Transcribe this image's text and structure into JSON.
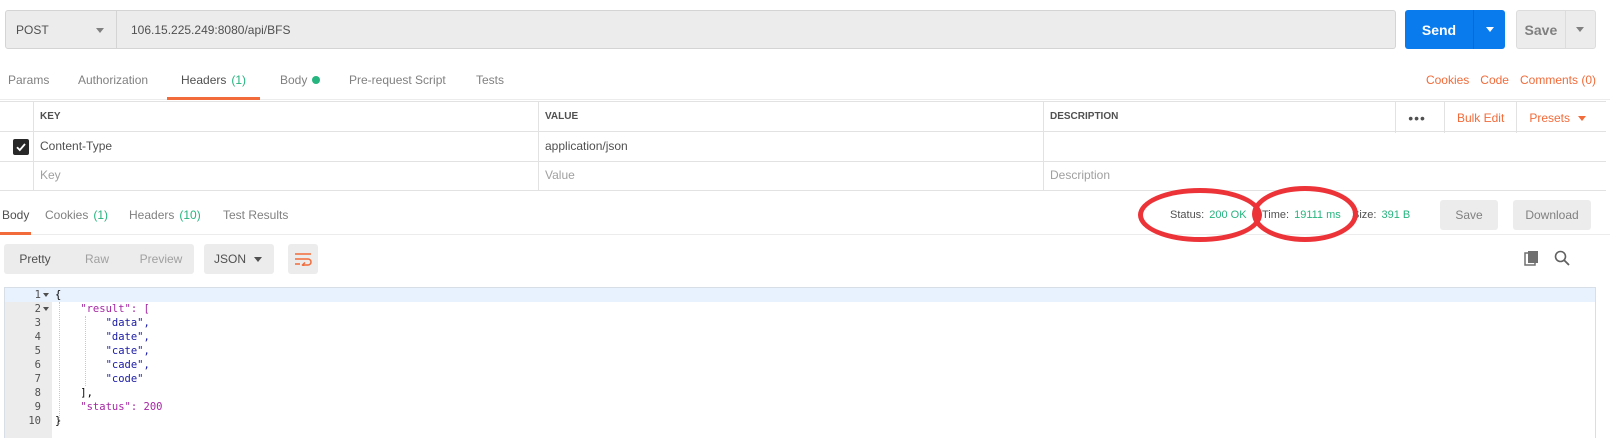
{
  "request": {
    "method": "POST",
    "url": "106.15.225.249:8080/api/BFS",
    "send_label": "Send",
    "save_label": "Save"
  },
  "request_tabs": [
    {
      "label": "Params",
      "count": ""
    },
    {
      "label": "Authorization",
      "count": ""
    },
    {
      "label": "Headers",
      "count": "(1)"
    },
    {
      "label": "Body",
      "count": ""
    },
    {
      "label": "Pre-request Script",
      "count": ""
    },
    {
      "label": "Tests",
      "count": ""
    }
  ],
  "active_request_tab": "Headers",
  "request_links": {
    "cookies": "Cookies",
    "code": "Code",
    "comments": "Comments (0)"
  },
  "headers_table": {
    "columns": [
      "KEY",
      "VALUE",
      "DESCRIPTION"
    ],
    "rows": [
      {
        "checked": true,
        "key": "Content-Type",
        "value": "application/json",
        "description": ""
      }
    ],
    "placeholders": {
      "key": "Key",
      "value": "Value",
      "description": "Description"
    },
    "actions": {
      "more": "•••",
      "bulk_edit": "Bulk Edit",
      "presets": "Presets"
    }
  },
  "response_tabs": [
    {
      "label": "Body",
      "count": ""
    },
    {
      "label": "Cookies",
      "count": "(1)"
    },
    {
      "label": "Headers",
      "count": "(10)"
    },
    {
      "label": "Test Results",
      "count": ""
    }
  ],
  "response_meta": {
    "status_label": "Status:",
    "status_value": "200 OK",
    "time_label": "Time:",
    "time_value": "19111 ms",
    "size_label": "Size:",
    "size_value": "391 B",
    "save_label": "Save",
    "download_label": "Download"
  },
  "view_modes": [
    "Pretty",
    "Raw",
    "Preview"
  ],
  "active_view_mode": "Pretty",
  "format": "JSON",
  "icons": {
    "wrap": "wrap-lines-icon",
    "copy": "copy-icon",
    "search": "search-icon",
    "checkbox": "checkmark-icon"
  },
  "colors": {
    "accent_orange": "#f26b3a",
    "send_blue": "#097bed",
    "status_green": "#26b47f",
    "annotation_red": "#ec3338"
  },
  "code_lines": [
    {
      "n": "1",
      "text": "{"
    },
    {
      "n": "2",
      "text": "    \"result\": ["
    },
    {
      "n": "3",
      "text": "        \"data\","
    },
    {
      "n": "4",
      "text": "        \"date\","
    },
    {
      "n": "5",
      "text": "        \"cate\","
    },
    {
      "n": "6",
      "text": "        \"cade\","
    },
    {
      "n": "7",
      "text": "        \"code\""
    },
    {
      "n": "8",
      "text": "    ],"
    },
    {
      "n": "9",
      "text": "    \"status\": 200"
    },
    {
      "n": "10",
      "text": "}"
    }
  ]
}
